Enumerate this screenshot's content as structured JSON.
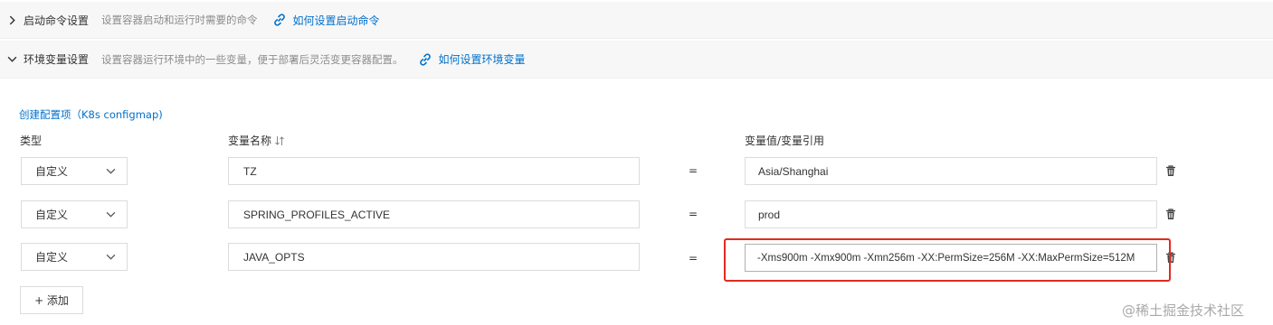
{
  "sections": [
    {
      "title": "启动命令设置",
      "desc": "设置容器启动和运行时需要的命令",
      "help": "如何设置启动命令",
      "expanded": false
    },
    {
      "title": "环境变量设置",
      "desc": "设置容器运行环境中的一些变量，便于部署后灵活变更容器配置。",
      "help": "如何设置环境变量",
      "expanded": true
    }
  ],
  "create_link": "创建配置项（K8s configmap)",
  "columns": {
    "type": "类型",
    "name": "变量名称",
    "value": "变量值/变量引用"
  },
  "equals": "=",
  "rows": [
    {
      "type": "自定义",
      "name": "TZ",
      "value": "Asia/Shanghai"
    },
    {
      "type": "自定义",
      "name": "SPRING_PROFILES_ACTIVE",
      "value": "prod"
    },
    {
      "type": "自定义",
      "name": "JAVA_OPTS",
      "value": "-Xms900m -Xmx900m -Xmn256m -XX:PermSize=256M -XX:MaxPermSize=512M"
    }
  ],
  "add_button": "+ 添加",
  "watermark": "@稀土掘金技术社区",
  "colors": {
    "accent": "#0070cc",
    "highlight": "#e02b20",
    "section_bg": "#f7f7f7"
  },
  "icons": {
    "collapsed": "chevron-right-icon",
    "expanded": "chevron-down-icon",
    "help": "link-icon",
    "sort": "sort-icon",
    "select": "chevron-down-icon",
    "delete": "trash-icon"
  }
}
